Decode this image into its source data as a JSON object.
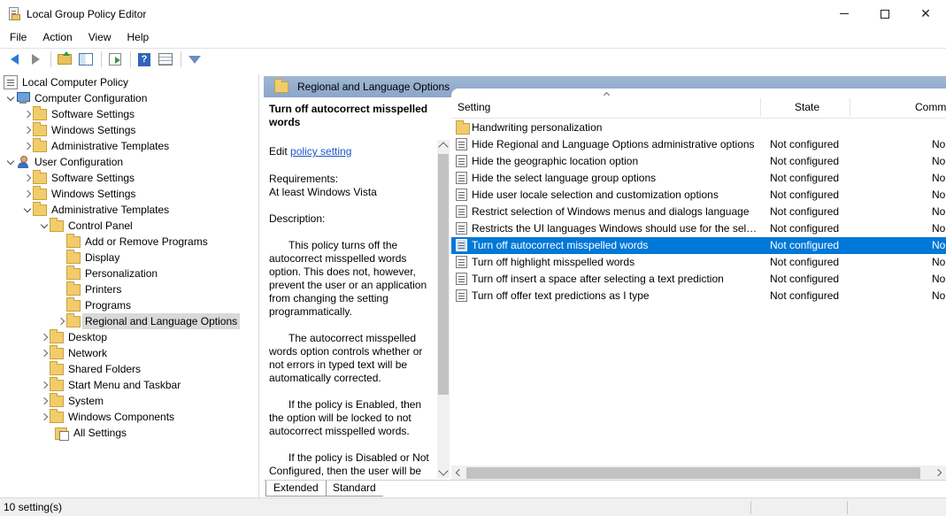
{
  "window": {
    "title": "Local Group Policy Editor",
    "controls": {
      "minimize": "",
      "maximize": "",
      "close": "✕"
    }
  },
  "menu": [
    "File",
    "Action",
    "View",
    "Help"
  ],
  "toolbar": {
    "icons": [
      "back-arrow-icon",
      "forward-arrow-icon",
      "up-folder-icon",
      "show-hide-tree-icon",
      "export-list-icon",
      "help-icon",
      "properties-icon",
      "filter-icon"
    ],
    "help_glyph": "?"
  },
  "tree": {
    "root": "Local Computer Policy",
    "computer_configuration": "Computer Configuration",
    "cc_software_settings": "Software Settings",
    "cc_windows_settings": "Windows Settings",
    "cc_administrative_templates": "Administrative Templates",
    "user_configuration": "User Configuration",
    "uc_software_settings": "Software Settings",
    "uc_windows_settings": "Windows Settings",
    "uc_administrative_templates": "Administrative Templates",
    "control_panel": "Control Panel",
    "add_remove_programs": "Add or Remove Programs",
    "display": "Display",
    "personalization": "Personalization",
    "printers": "Printers",
    "programs": "Programs",
    "regional_language_options": "Regional and Language Options",
    "desktop": "Desktop",
    "network": "Network",
    "shared_folders": "Shared Folders",
    "start_menu_taskbar": "Start Menu and Taskbar",
    "system": "System",
    "windows_components": "Windows Components",
    "all_settings": "All Settings"
  },
  "right_pane": {
    "header": "Regional and Language Options",
    "description": {
      "title": "Turn off autocorrect misspelled words",
      "edit_prefix": "Edit ",
      "edit_link": "policy setting",
      "requirements_label": "Requirements:",
      "requirements_value": "At least Windows Vista",
      "description_label": "Description:",
      "p1": "This policy turns off the autocorrect misspelled words option. This does not, however, prevent the user or an application from changing the setting programmatically.",
      "p2": "The autocorrect misspelled words option controls whether or not errors in typed text will be automatically corrected.",
      "p3": "If the policy is Enabled, then the option will be locked to not autocorrect misspelled words.",
      "p4": "If the policy is Disabled or Not Configured, then the user will be"
    },
    "columns": {
      "setting": "Setting",
      "state": "State",
      "comment": "Comm"
    },
    "rows": [
      {
        "name": "Handwriting personalization",
        "state": "",
        "comment": "",
        "type": "folder"
      },
      {
        "name": "Hide Regional and Language Options administrative options",
        "state": "Not configured",
        "comment": "No"
      },
      {
        "name": "Hide the geographic location option",
        "state": "Not configured",
        "comment": "No"
      },
      {
        "name": "Hide the select language group options",
        "state": "Not configured",
        "comment": "No"
      },
      {
        "name": "Hide user locale selection and customization options",
        "state": "Not configured",
        "comment": "No"
      },
      {
        "name": "Restrict selection of Windows menus and dialogs language",
        "state": "Not configured",
        "comment": "No"
      },
      {
        "name": "Restricts the UI languages Windows should use for the selec...",
        "state": "Not configured",
        "comment": "No"
      },
      {
        "name": "Turn off autocorrect misspelled words",
        "state": "Not configured",
        "comment": "No",
        "selected": true
      },
      {
        "name": "Turn off highlight misspelled words",
        "state": "Not configured",
        "comment": "No"
      },
      {
        "name": "Turn off insert a space after selecting a text prediction",
        "state": "Not configured",
        "comment": "No"
      },
      {
        "name": "Turn off offer text predictions as I type",
        "state": "Not configured",
        "comment": "No"
      }
    ],
    "tabs": {
      "extended": "Extended",
      "standard": "Standard"
    }
  },
  "status": {
    "text": "10 setting(s)"
  },
  "colors": {
    "selection": "#0078d7",
    "header_band": "#9fb7d4",
    "link": "#1a56c4"
  }
}
